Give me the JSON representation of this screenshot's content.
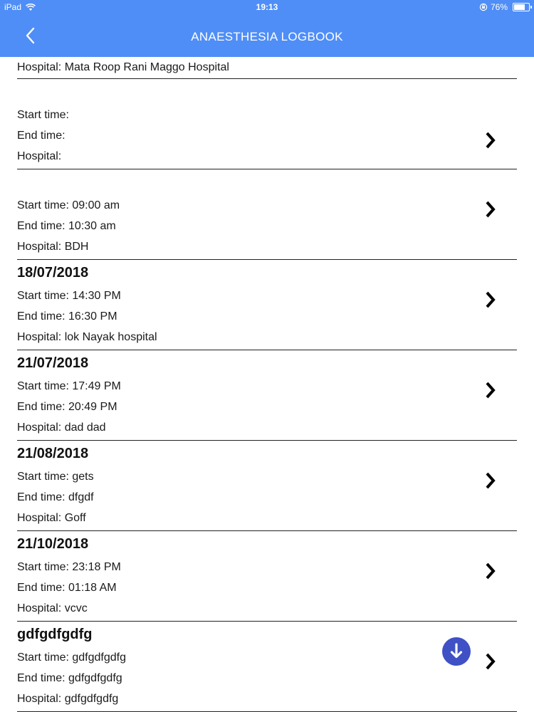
{
  "status": {
    "device": "iPad",
    "time": "19:13",
    "battery": "76%",
    "battery_level": 0.76
  },
  "nav": {
    "title": "ANAESTHESIA LOGBOOK"
  },
  "entries": [
    {
      "date": "",
      "start": "",
      "end": "",
      "hospital": "Hospital: Mata Roop Rani Maggo Hospital"
    },
    {
      "date": "",
      "start": "Start time:",
      "end": "End time:",
      "hospital": "Hospital:"
    },
    {
      "date": "",
      "start": "Start time: 09:00 am",
      "end": "End time: 10:30 am",
      "hospital": "Hospital: BDH"
    },
    {
      "date": "18/07/2018",
      "start": "Start time: 14:30 PM",
      "end": "End time: 16:30 PM",
      "hospital": "Hospital: lok Nayak hospital"
    },
    {
      "date": "21/07/2018",
      "start": "Start time: 17:49 PM",
      "end": "End time: 20:49 PM",
      "hospital": "Hospital: dad dad"
    },
    {
      "date": "21/08/2018",
      "start": "Start time: gets",
      "end": "End time: dfgdf",
      "hospital": "Hospital: Goff"
    },
    {
      "date": "21/10/2018",
      "start": "Start time: 23:18 PM",
      "end": "End time: 01:18 AM",
      "hospital": "Hospital: vcvc"
    },
    {
      "date": "gdfgdfgdfg",
      "start": "Start time: gdfgdfgdfg",
      "end": "End time: gdfgdfgdfg",
      "hospital": "Hospital: gdfgdfgdfg"
    }
  ],
  "icons": {
    "back": "chevron-left-icon",
    "row": "chevron-right-icon",
    "fab": "arrow-down-icon"
  },
  "colors": {
    "header": "#4f8ef7",
    "fab": "#3f51c4"
  }
}
